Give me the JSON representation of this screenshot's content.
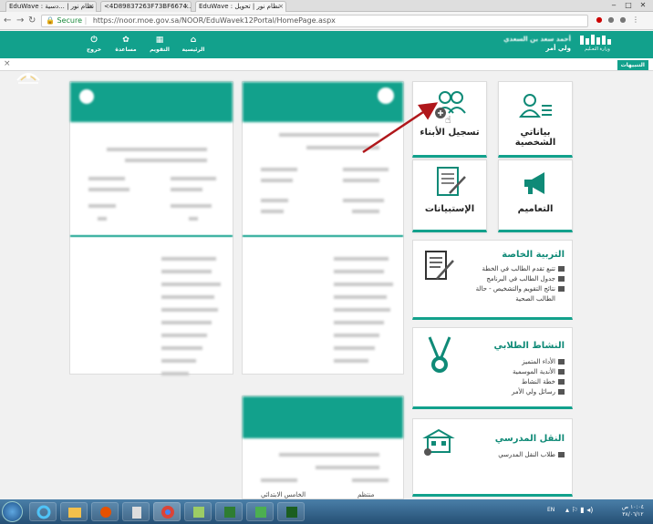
{
  "browser": {
    "tabs": [
      {
        "label": "EduWave : نظام نور | ...دسية"
      },
      {
        "label": "<4D89837263F73BF6674..."
      },
      {
        "label": "EduWave : نظام نور | تحويل"
      }
    ],
    "secure_label": "Secure",
    "url": "https://noor.moe.gov.sa/NOOR/EduWavek12Portal/HomePage.aspx"
  },
  "header": {
    "nav": [
      {
        "label": "الرئيسية",
        "icon": "home-icon"
      },
      {
        "label": "التقويم",
        "icon": "calendar-icon"
      },
      {
        "label": "مساعدة",
        "icon": "help-icon"
      },
      {
        "label": "خروج",
        "icon": "logout-icon"
      }
    ],
    "user_name": "أحمد سعد بن السعدي",
    "user_role": "ولي أمر",
    "ministry_label": "وزارة التعـليم"
  },
  "notif_label": "التنبيهات",
  "tiles": [
    {
      "label": "بياناتي الشخصية",
      "icon": "person-id-icon"
    },
    {
      "label": "تسجيل الأبناء",
      "icon": "add-children-icon"
    },
    {
      "label": "التعاميم",
      "icon": "megaphone-icon"
    },
    {
      "label": "الإستبيانات",
      "icon": "survey-icon"
    }
  ],
  "panels": {
    "special_ed": {
      "title": "التربية الخاصة",
      "items": [
        "تتبع تقدم الطالب في الخطة",
        "جدول الطالب في البرنامج",
        "نتائج التقويم والتشخيص - حالة",
        "الطالب الصحية"
      ]
    },
    "student_activity": {
      "title": "النشاط الطلابي",
      "items": [
        "الأداء المتميز",
        "الأندية الموسمية",
        "خطة النشاط",
        "رسائل ولي الأمر"
      ]
    },
    "transport": {
      "title": "النقل المدرسي",
      "items": [
        "طلاب النقل المدرسي"
      ]
    }
  },
  "student_cards": {
    "bottom_row": [
      "منتظم",
      "الخامس الابتدائي"
    ]
  },
  "taskbar": {
    "lang": "EN",
    "time": "١٠:٠٤ ص",
    "date": "٣٨/٠٦/١٢"
  },
  "colors": {
    "accent": "#12a18c",
    "arrow": "#b0171b"
  }
}
